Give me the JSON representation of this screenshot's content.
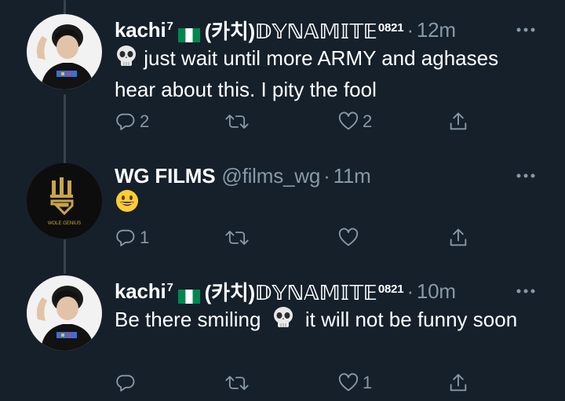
{
  "tweets": [
    {
      "name": "kachi",
      "name_sup": "7",
      "name_suffix": "(카치)𝔻𝕐ℕ𝔸𝕄𝕀𝕋𝔼",
      "name_suffix_sup": "0821",
      "separator": "·",
      "time": "12m",
      "text_emoji": "skull",
      "text": "just wait until more ARMY and aghases hear about this. I pity the fool",
      "reply_count": "2",
      "retweet_count": "",
      "like_count": "2"
    },
    {
      "name": "WG FILMS",
      "handle": "@films_wg",
      "separator": "·",
      "time": "11m",
      "text_emoji": "grinning-face",
      "logo_text": "WOLE GENIUS",
      "reply_count": "1",
      "retweet_count": "",
      "like_count": ""
    },
    {
      "name": "kachi",
      "name_sup": "7",
      "name_suffix": "(카치)𝔻𝕐ℕ𝔸𝕄𝕀𝕋𝔼",
      "name_suffix_sup": "0821",
      "separator": "·",
      "time": "10m",
      "text_part1": "Be there smiling",
      "text_emoji": "skull",
      "text_part2": "it will not be funny soon",
      "reply_count": "",
      "retweet_count": "",
      "like_count": "1"
    }
  ],
  "colors": {
    "background": "#15202b",
    "secondary_text": "#8899a6",
    "thread_line": "#38444d",
    "flag_green": "#008751"
  },
  "icons": [
    "reply-icon",
    "retweet-icon",
    "like-icon",
    "share-icon",
    "more-icon",
    "nigeria-flag-icon"
  ]
}
